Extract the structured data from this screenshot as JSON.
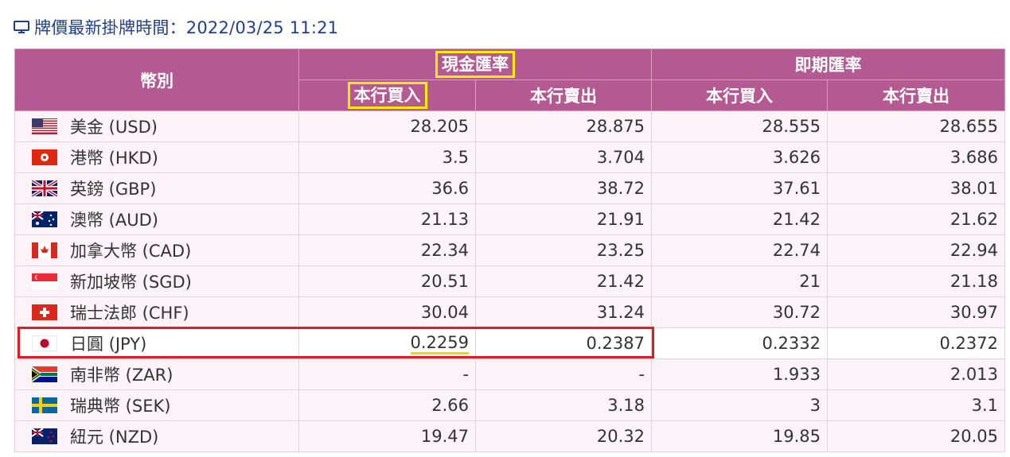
{
  "header": {
    "timestamp_text": "牌價最新掛牌時間：2022/03/25 11:21",
    "accent_color": "#1f3f8c"
  },
  "table": {
    "col_currency": "幣別",
    "group_cash": "現金匯率",
    "group_spot": "即期匯率",
    "sub_buy": "本行買入",
    "sub_sell": "本行賣出",
    "header_bg": "#b45991",
    "rows": [
      {
        "flag": "us-flag-icon",
        "currency": "美金 (USD)",
        "cash_buy": "28.205",
        "cash_sell": "28.875",
        "spot_buy": "28.555",
        "spot_sell": "28.655"
      },
      {
        "flag": "hk-flag-icon",
        "currency": "港幣 (HKD)",
        "cash_buy": "3.5",
        "cash_sell": "3.704",
        "spot_buy": "3.626",
        "spot_sell": "3.686"
      },
      {
        "flag": "gb-flag-icon",
        "currency": "英鎊 (GBP)",
        "cash_buy": "36.6",
        "cash_sell": "38.72",
        "spot_buy": "37.61",
        "spot_sell": "38.01"
      },
      {
        "flag": "au-flag-icon",
        "currency": "澳幣 (AUD)",
        "cash_buy": "21.13",
        "cash_sell": "21.91",
        "spot_buy": "21.42",
        "spot_sell": "21.62"
      },
      {
        "flag": "ca-flag-icon",
        "currency": "加拿大幣 (CAD)",
        "cash_buy": "22.34",
        "cash_sell": "23.25",
        "spot_buy": "22.74",
        "spot_sell": "22.94"
      },
      {
        "flag": "sg-flag-icon",
        "currency": "新加坡幣 (SGD)",
        "cash_buy": "20.51",
        "cash_sell": "21.42",
        "spot_buy": "21",
        "spot_sell": "21.18"
      },
      {
        "flag": "ch-flag-icon",
        "currency": "瑞士法郎 (CHF)",
        "cash_buy": "30.04",
        "cash_sell": "31.24",
        "spot_buy": "30.72",
        "spot_sell": "30.97"
      },
      {
        "flag": "jp-flag-icon",
        "currency": "日圓 (JPY)",
        "cash_buy": "0.2259",
        "cash_sell": "0.2387",
        "spot_buy": "0.2332",
        "spot_sell": "0.2372"
      },
      {
        "flag": "za-flag-icon",
        "currency": "南非幣 (ZAR)",
        "cash_buy": "-",
        "cash_sell": "-",
        "spot_buy": "1.933",
        "spot_sell": "2.013"
      },
      {
        "flag": "se-flag-icon",
        "currency": "瑞典幣 (SEK)",
        "cash_buy": "2.66",
        "cash_sell": "3.18",
        "spot_buy": "3",
        "spot_sell": "3.1"
      },
      {
        "flag": "nz-flag-icon",
        "currency": "紐元 (NZD)",
        "cash_buy": "19.47",
        "cash_sell": "20.32",
        "spot_buy": "19.85",
        "spot_sell": "20.05"
      }
    ]
  },
  "annotations": {
    "highlight_yellow": "#ffee00",
    "highlight_red": "#e01b22"
  }
}
